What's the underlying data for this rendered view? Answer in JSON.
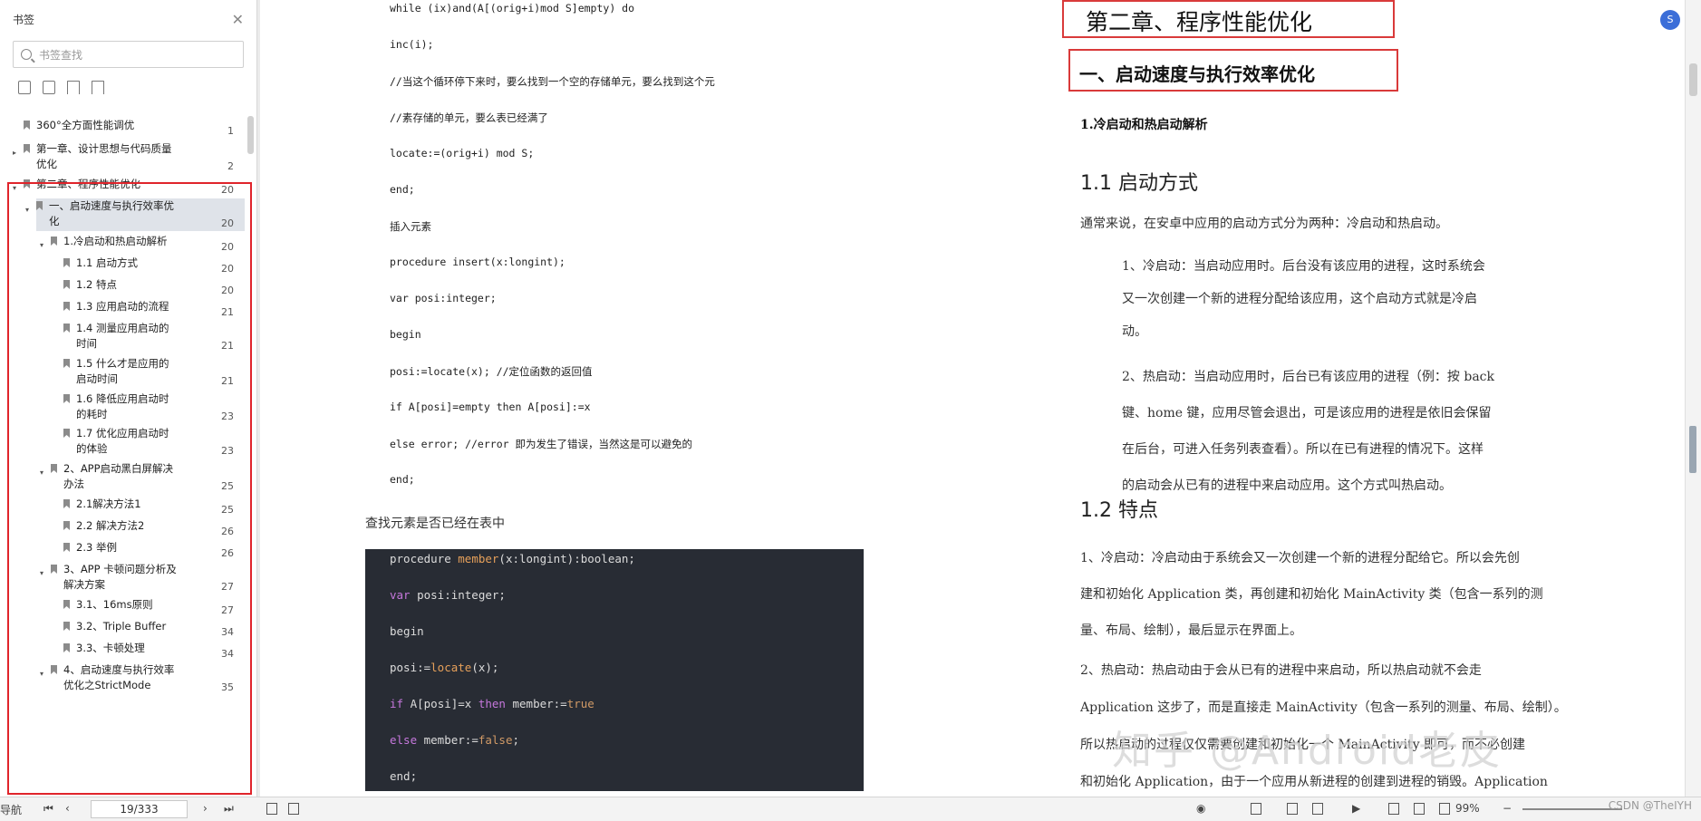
{
  "sidebar": {
    "title": "书签",
    "search_placeholder": "书签查找",
    "items": [
      {
        "label": "360°全方面性能调优",
        "page": "1"
      },
      {
        "label": "第一章、设计思想与代码质量",
        "label2": "优化",
        "page": "2"
      },
      {
        "label": "第二章、程序性能优化",
        "page": "20"
      },
      {
        "label": "一、启动速度与执行效率优",
        "label2": "化",
        "page": "20"
      },
      {
        "label": "1.冷启动和热启动解析",
        "page": "20"
      },
      {
        "label": "1.1 启动方式",
        "page": "20"
      },
      {
        "label": "1.2 特点",
        "page": "20"
      },
      {
        "label": "1.3 应用启动的流程",
        "page": "21"
      },
      {
        "label": "1.4 测量应用启动的",
        "label2": "时间",
        "page": "21"
      },
      {
        "label": "1.5 什么才是应用的",
        "label2": "启动时间",
        "page": "21"
      },
      {
        "label": "1.6 降低应用启动时",
        "label2": "的耗时",
        "page": "23"
      },
      {
        "label": "1.7 优化应用启动时",
        "label2": "的体验",
        "page": "23"
      },
      {
        "label": "2、APP启动黑白屏解决",
        "label2": "办法",
        "page": "25"
      },
      {
        "label": "2.1解决方法1",
        "page": "25"
      },
      {
        "label": "2.2 解决方法2",
        "page": "26"
      },
      {
        "label": "2.3 举例",
        "page": "26"
      },
      {
        "label": "3、APP 卡顿问题分析及",
        "label2": "解决方案",
        "page": "27"
      },
      {
        "label": "3.1、16ms原则",
        "page": "27"
      },
      {
        "label": "3.2、Triple Buffer",
        "page": "34"
      },
      {
        "label": "3.3、卡顿处理",
        "page": "34"
      },
      {
        "label": "4、启动速度与执行效率",
        "label2": "优化之StrictMode",
        "page": "35"
      }
    ]
  },
  "left_page": {
    "code_lines": [
      "while (ix)and(A[(orig+i)mod S]empty) do",
      "inc(i);",
      "//当这个循环停下来时，要么找到一个空的存储单元，要么找到这个元",
      "//素存储的单元，要么表已经满了",
      "locate:=(orig+i) mod S;",
      "end;",
      "插入元素",
      "procedure insert(x:longint);",
      "var posi:integer;",
      "begin",
      "posi:=locate(x); //定位函数的返回值",
      "if A[posi]=empty then A[posi]:=x",
      "else error; //error 即为发生了错误，当然这是可以避免的",
      "end;"
    ],
    "prose": "查找元素是否已经在表中",
    "dark_code": {
      "l1a": "procedure ",
      "l1b": "member",
      "l1c": "(x:longint):boolean;",
      "l2a": "var",
      "l2b": " posi:integer;",
      "l3": "begin",
      "l4a": "posi:=",
      "l4b": "locate",
      "l4c": "(x);",
      "l5a": "if",
      "l5b": " A[posi]=x ",
      "l5c": "then",
      "l5d": " member:=",
      "l5e": "true",
      "l6a": "else",
      "l6b": " member:=",
      "l6c": "false",
      "l6d": ";",
      "l7": "end;"
    }
  },
  "right_page": {
    "chapter_title": "第二章、程序性能优化",
    "section_title": "一、启动速度与执行效率优化",
    "sub1": "1.冷启动和热启动解析",
    "h11": "1.1  启动方式",
    "p1": "通常来说，在安卓中应用的启动方式分为两种：冷启动和热启动。",
    "cold": [
      "1、冷启动：当启动应用时。后台没有该应用的进程，这时系统会",
      "又一次创建一个新的进程分配给该应用，这个启动方式就是冷启",
      "动。"
    ],
    "hot": [
      "2、热启动：当启动应用时，后台已有该应用的进程（例：按 back",
      "键、home 键，应用尽管会退出，可是该应用的进程是依旧会保留",
      "在后台，可进入任务列表查看）。所以在已有进程的情况下。这样",
      "的启动会从已有的进程中来启动应用。这个方式叫热启动。"
    ],
    "h12": "1.2  特点",
    "feat1": [
      "1、冷启动：冷启动由于系统会又一次创建一个新的进程分配给它。所以会先创",
      "建和初始化 Application 类，再创建和初始化 MainActivity 类（包含一系列的测",
      "量、布局、绘制），最后显示在界面上。"
    ],
    "feat2": [
      "2、热启动：热启动由于会从已有的进程中来启动，所以热启动就不会走",
      "Application 这步了，而是直接走 MainActivity（包含一系列的测量、布局、绘制）。",
      "所以热启动的过程仅仅需要创建和初始化一个 MainActivity 即可，而不必创建",
      "和初始化 Application，由于一个应用从新进程的创建到进程的销毁。Application"
    ]
  },
  "watermark": "知乎 @Android老皮",
  "csdn": "CSDN @TheIYH",
  "statusbar": {
    "nav_label": "导航",
    "page_indicator": "19/333",
    "zoom": "99%"
  },
  "side_badge": "S"
}
